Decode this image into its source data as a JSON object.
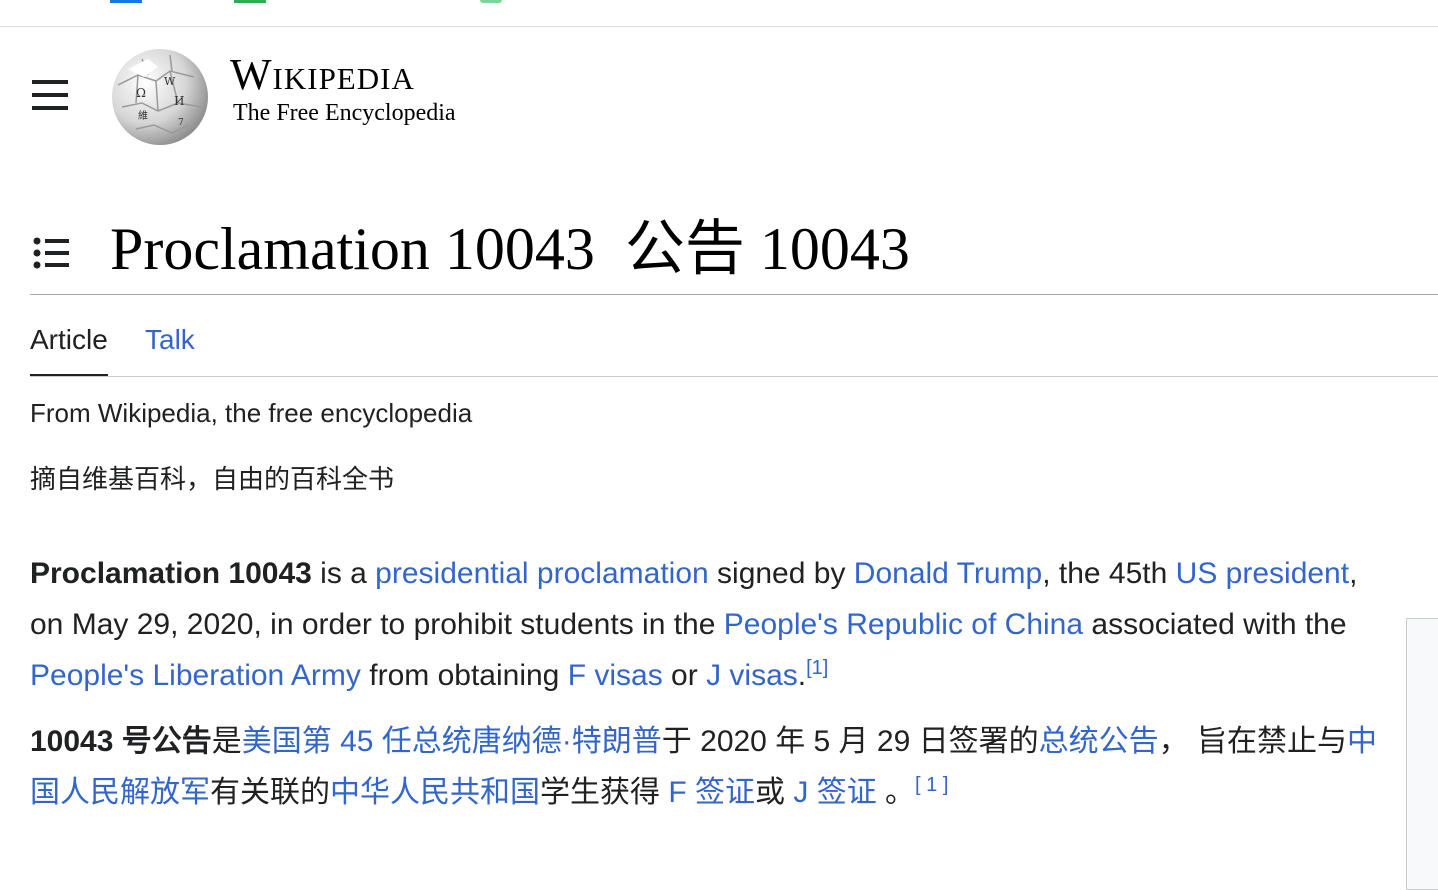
{
  "header": {
    "wordmark": "Wikipedia",
    "tagline": "The Free Encyclopedia",
    "colors": {
      "link": "#3366cc",
      "text": "#202122"
    }
  },
  "page": {
    "title": "Proclamation 10043",
    "title_zh": "公告 10043"
  },
  "tabs": [
    {
      "label": "Article",
      "active": true
    },
    {
      "label": "Talk",
      "active": false
    }
  ],
  "from": {
    "en": "From Wikipedia, the free encyclopedia",
    "zh": "摘自维基百科，自由的百科全书"
  },
  "para_en": {
    "bold_subject": "Proclamation 10043",
    "t1": " is a ",
    "l_presidential_proclamation": "presidential proclamation",
    "t2": " signed by ",
    "l_donald_trump": "Donald Trump",
    "t3": ", the 45th ",
    "l_us_president": "US president",
    "t4": ", on May 29, 2020, in order to prohibit students in the ",
    "l_prc": "People's Republic of China",
    "t5": " associated with the ",
    "l_pla": "People's Liberation Army",
    "t6": " from obtaining ",
    "l_f_visas": "F visas",
    "t7": " or ",
    "l_j_visas": "J visas",
    "t8": ".",
    "ref": "[1]"
  },
  "para_zh": {
    "bold_subject": "10043 号公告",
    "t1": "是",
    "l_trump": "美国第 45 任总统唐纳德·特朗普",
    "t2": "于 2020 年 5 月 29 日签署的",
    "l_proclamation": "总统公告",
    "t3": "， 旨在禁止与",
    "l_pla": "中国人民解放军",
    "t4": "有关联的",
    "l_prc": "中华人民共和国",
    "t5": "学生获得 ",
    "l_f_visa": "F 签证",
    "t6": "或 ",
    "l_j_visa": "J 签证",
    "t7": " 。",
    "ref": "[ 1 ]"
  },
  "icons": [
    "menu-icon",
    "wikipedia-globe-logo",
    "table-of-contents-icon"
  ]
}
